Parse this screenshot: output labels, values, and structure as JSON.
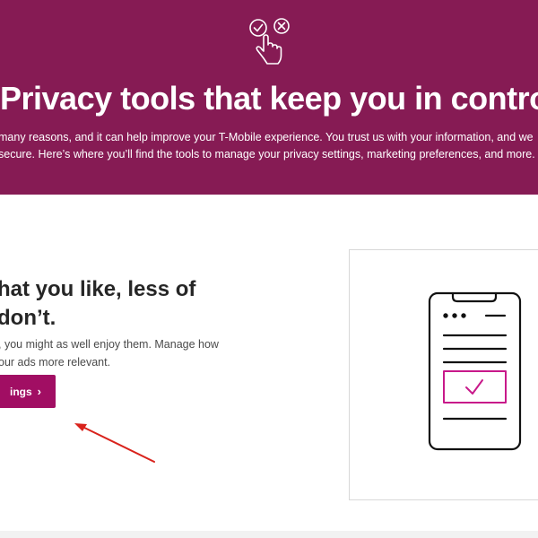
{
  "hero": {
    "title": "Privacy tools that keep you in control.",
    "description_line1": "many reasons, and it can help improve your T-Mobile experience. You trust us with your information, and we",
    "description_line2": "secure. Here’s where you’ll find the tools to manage your privacy settings, marketing preferences, and more.",
    "background_color": "#861b54",
    "icon": "privacy-choice-hand-icon"
  },
  "feature": {
    "title_line1": "hat you like, less of",
    "title_line2": "don’t.",
    "description_line1": ", you might as well enjoy them. Manage how",
    "description_line2": "our ads more relevant.",
    "cta_label": "ings",
    "cta_icon": "chevron-right-icon",
    "cta_color": "#a10e63",
    "illustration": "phone-checkbox-illustration",
    "accent_color": "#c8198a"
  },
  "annotation": {
    "arrow_color": "#d9231c"
  }
}
